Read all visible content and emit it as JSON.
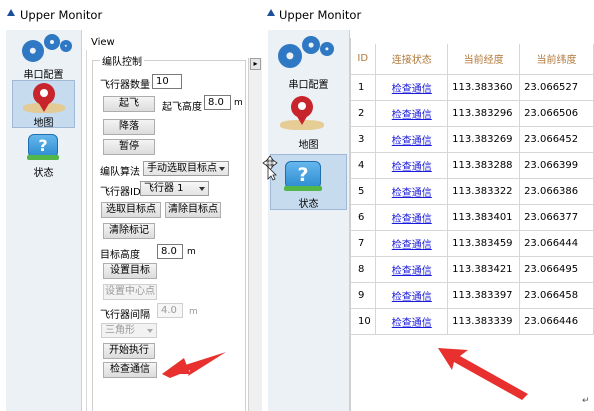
{
  "left_window": {
    "title": "Upper Monitor",
    "nav": [
      {
        "label": "串口配置",
        "icon": "gears-icon",
        "selected": false
      },
      {
        "label": "地图",
        "icon": "map-pin-icon",
        "selected": true
      },
      {
        "label": "状态",
        "icon": "question-icon",
        "selected": false
      }
    ],
    "view_label": "View",
    "scroll_glyph": "▸",
    "group_title": "编队控制",
    "form": {
      "drone_count_label": "飞行器数量",
      "drone_count_value": "10",
      "takeoff_button": "起飞",
      "takeoff_height_label": "起飞高度",
      "takeoff_height_value": "8.0",
      "takeoff_height_unit": "m",
      "land_button": "降落",
      "pause_button": "暂停",
      "formation_algo_label": "编队算法",
      "formation_algo_value": "手动选取目标点",
      "drone_id_label": "飞行器ID",
      "drone_id_value": "飞行器 1",
      "pick_target_button": "选取目标点",
      "clear_target_button": "清除目标点",
      "clear_marks_button": "清除标记",
      "target_height_label": "目标高度",
      "target_height_value": "8.0",
      "target_height_unit": "m",
      "set_target_button": "设置目标",
      "set_center_button": "设置中心点",
      "spacing_label": "飞行器间隔",
      "spacing_value": "4.0",
      "spacing_unit": "m",
      "shape_value": "三角形",
      "start_button": "开始执行",
      "check_comm_button": "检查通信"
    }
  },
  "right_window": {
    "title": "Upper Monitor",
    "nav": [
      {
        "label": "串口配置",
        "icon": "gears-icon",
        "selected": false
      },
      {
        "label": "地图",
        "icon": "map-pin-icon",
        "selected": false
      },
      {
        "label": "状态",
        "icon": "question-icon",
        "selected": true
      }
    ],
    "table": {
      "columns": [
        "ID",
        "连接状态",
        "当前经度",
        "当前纬度"
      ],
      "rows": [
        {
          "id": "1",
          "status": "检查通信",
          "lon": "113.383360",
          "lat": "23.066527"
        },
        {
          "id": "2",
          "status": "检查通信",
          "lon": "113.383296",
          "lat": "23.066506"
        },
        {
          "id": "3",
          "status": "检查通信",
          "lon": "113.383269",
          "lat": "23.066452"
        },
        {
          "id": "4",
          "status": "检查通信",
          "lon": "113.383288",
          "lat": "23.066399"
        },
        {
          "id": "5",
          "status": "检查通信",
          "lon": "113.383322",
          "lat": "23.066386"
        },
        {
          "id": "6",
          "status": "检查通信",
          "lon": "113.383401",
          "lat": "23.066377"
        },
        {
          "id": "7",
          "status": "检查通信",
          "lon": "113.383459",
          "lat": "23.066444"
        },
        {
          "id": "8",
          "status": "检查通信",
          "lon": "113.383421",
          "lat": "23.066495"
        },
        {
          "id": "9",
          "status": "检查通信",
          "lon": "113.383397",
          "lat": "23.066458"
        },
        {
          "id": "10",
          "status": "检查通信",
          "lon": "113.383339",
          "lat": "23.066446"
        }
      ]
    }
  },
  "colors": {
    "accent_arrow": "#e8312f",
    "header_text": "#b0793a",
    "link": "#1a1adb",
    "nav_selected": "#c7dbef"
  }
}
